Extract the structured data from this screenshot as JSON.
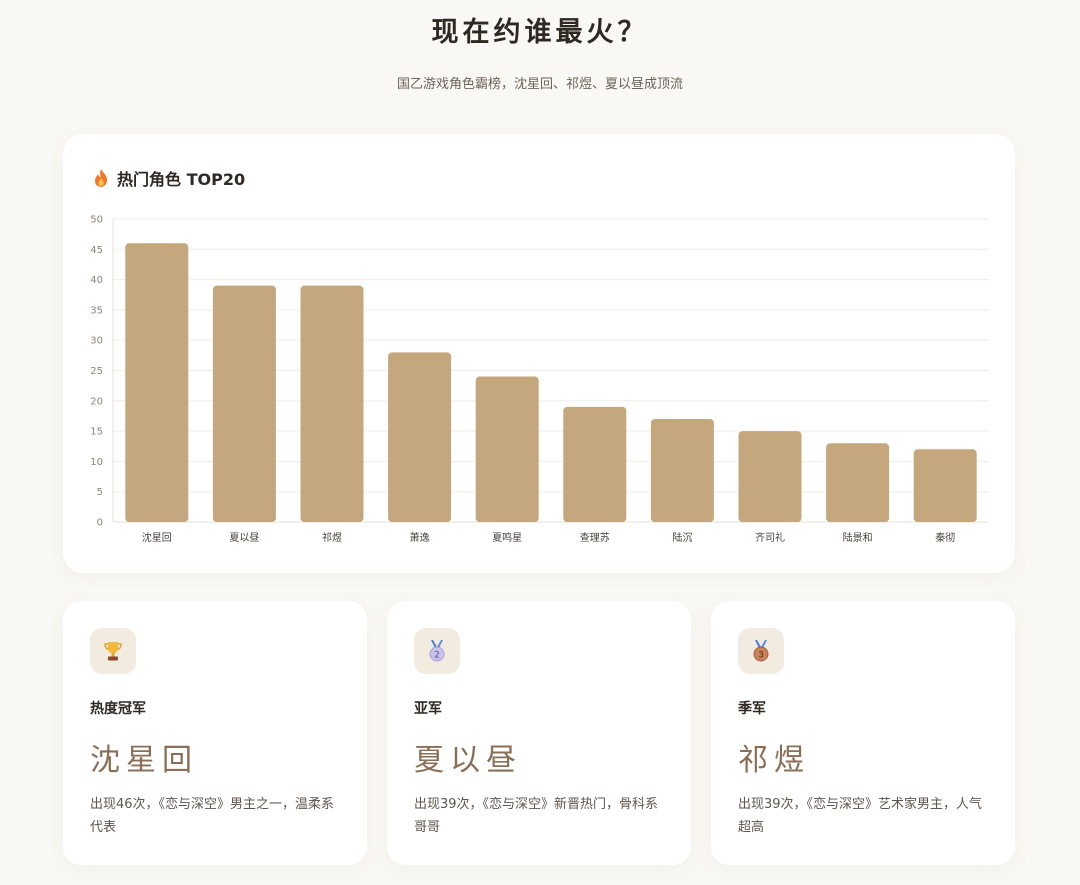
{
  "header": {
    "title": "现在约谁最火？",
    "subtitle": "国乙游戏角色霸榜，沈星回、祁煜、夏以昼成顶流"
  },
  "chart_card": {
    "title": "热门角色 TOP20",
    "icon": "fire-icon"
  },
  "chart_data": {
    "type": "bar",
    "title": "热门角色 TOP20",
    "categories": [
      "沈星回",
      "夏以昼",
      "祁煜",
      "萧逸",
      "夏鸣星",
      "查理苏",
      "陆沉",
      "齐司礼",
      "陆景和",
      "秦彻"
    ],
    "values": [
      46,
      39,
      39,
      28,
      24,
      19,
      17,
      15,
      13,
      12
    ],
    "ylim": [
      0,
      50
    ],
    "yticks": [
      0,
      5,
      10,
      15,
      20,
      25,
      30,
      35,
      40,
      45,
      50
    ],
    "xlabel": "",
    "ylabel": "",
    "grid": true,
    "bar_color": "#c4a77d"
  },
  "cards": [
    {
      "icon": "trophy-icon",
      "label": "热度冠军",
      "name": "沈星回",
      "description": "出现46次，《恋与深空》男主之一，温柔系代表"
    },
    {
      "icon": "silver-medal-icon",
      "medal_number": "2",
      "label": "亚军",
      "name": "夏以昼",
      "description": "出现39次，《恋与深空》新晋热门，骨科系哥哥"
    },
    {
      "icon": "bronze-medal-icon",
      "medal_number": "3",
      "label": "季军",
      "name": "祁煜",
      "description": "出现39次，《恋与深空》艺术家男主，人气超高"
    }
  ]
}
